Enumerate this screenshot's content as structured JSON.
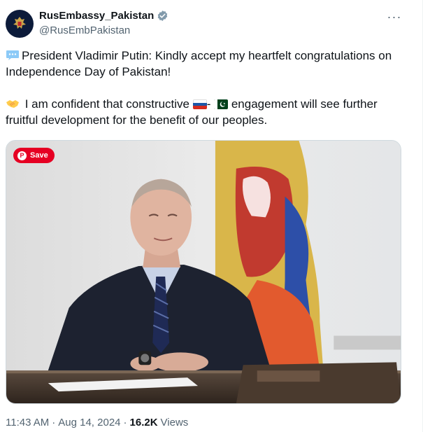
{
  "account": {
    "display_name": "RusEmbassy_Pakistan",
    "handle": "@RusEmbPakistan",
    "verified": true
  },
  "more_menu": {
    "label": "···"
  },
  "tweet": {
    "line1": "President Vladimir Putin: Kindly accept my heartfelt congratulations on Independence Day of Pakistan!",
    "line2_before": " I am confident that constructive ",
    "line2_sep": "- ",
    "line2_after": " engagement will see further fruitful development for the benefit of our peoples."
  },
  "media": {
    "save_label": "Save"
  },
  "meta": {
    "time": "11:43 AM",
    "separator1": "·",
    "date": "Aug 14, 2024",
    "separator2": "·",
    "views_count": "16.2K",
    "views_label": "Views"
  },
  "colors": {
    "text": "#0f1419",
    "secondary": "#536471",
    "verified_badge": "#829aab",
    "pinterest": "#e60023"
  },
  "icons": [
    "speech-bubble-icon",
    "handshake-icon",
    "russia-flag-icon",
    "pakistan-flag-icon",
    "verified-icon",
    "pinterest-icon",
    "more-icon"
  ]
}
